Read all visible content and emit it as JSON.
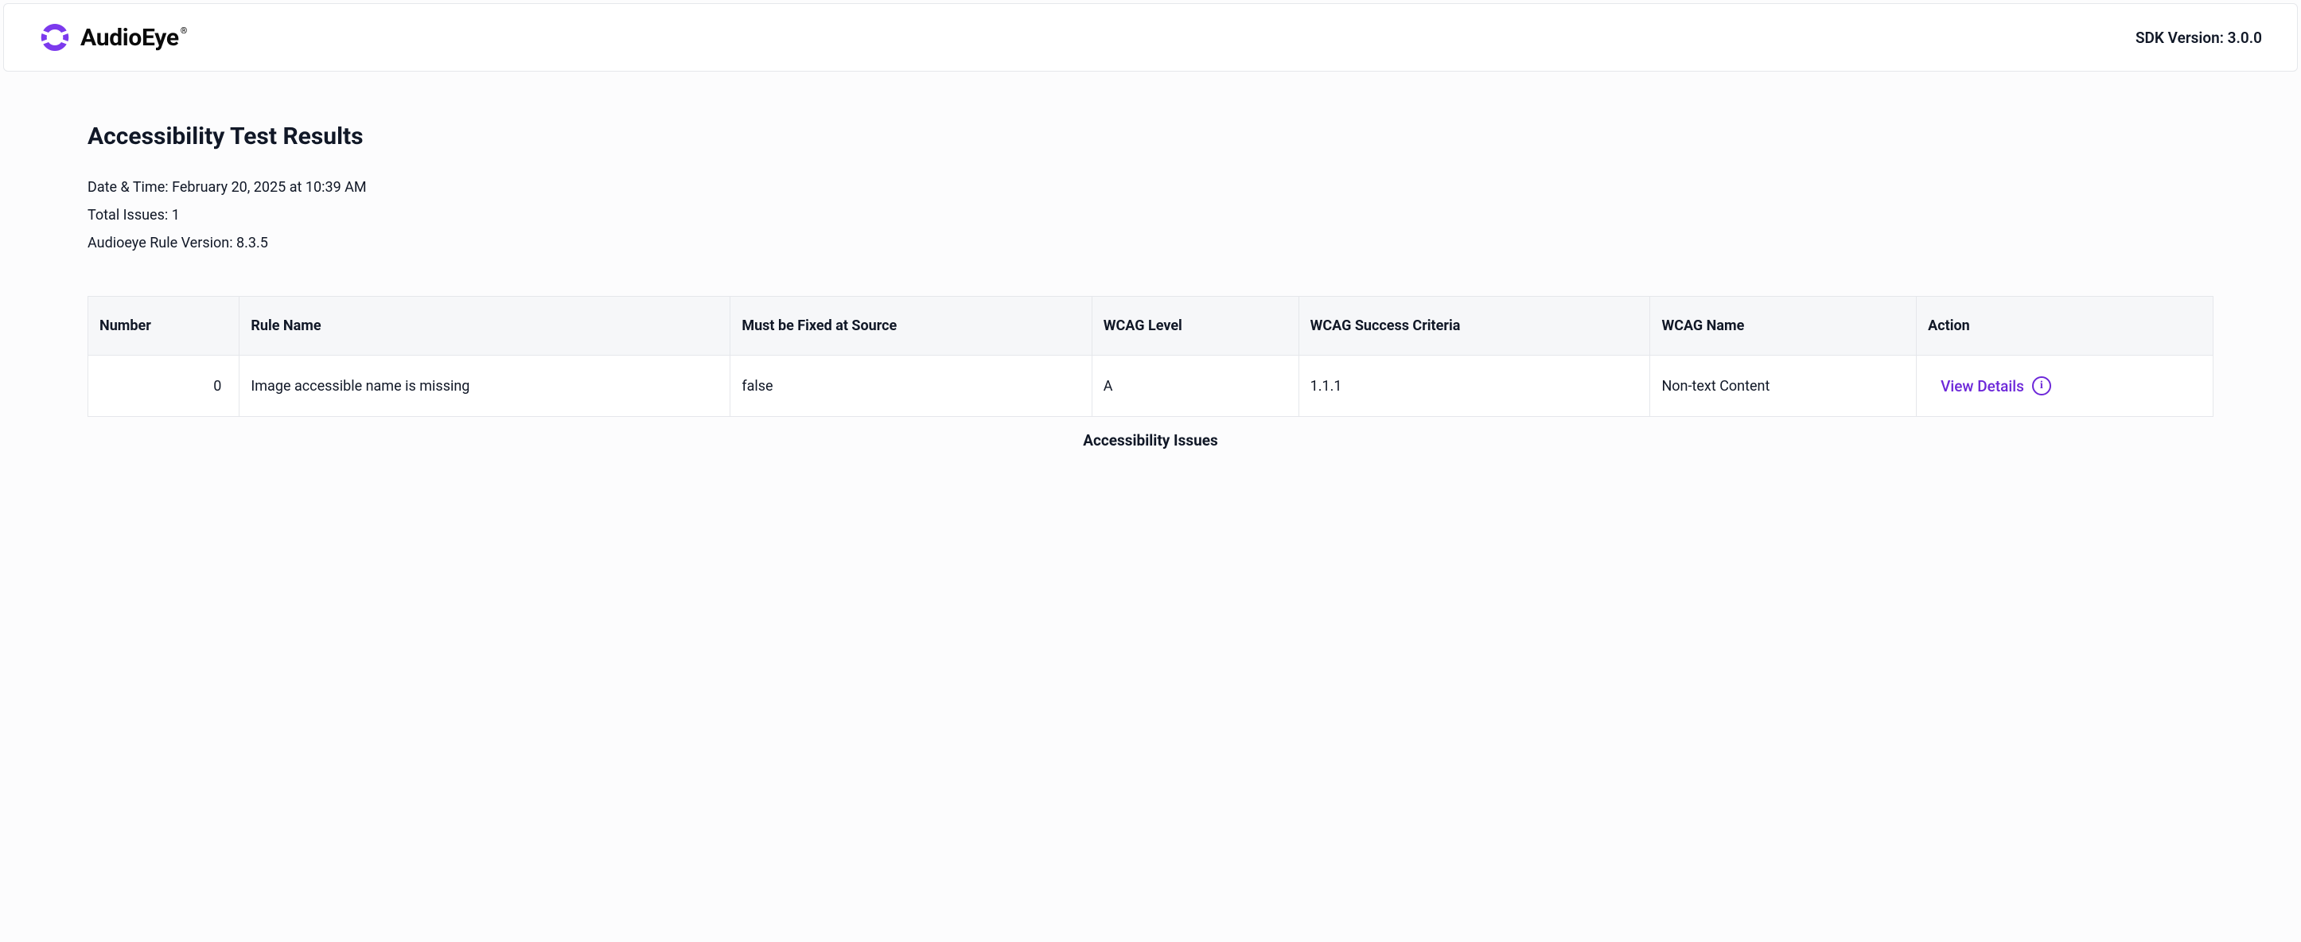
{
  "header": {
    "brand_name": "AudioEye",
    "sdk_version_label": "SDK Version: 3.0.0"
  },
  "main": {
    "title": "Accessibility Test Results",
    "meta": {
      "datetime_label": "Date & Time: ",
      "datetime_value": "February 20, 2025 at 10:39 AM",
      "total_issues_label": "Total Issues: ",
      "total_issues_value": "1",
      "rule_version_label": "Audioeye Rule Version: ",
      "rule_version_value": "8.3.5"
    },
    "table": {
      "headers": {
        "number": "Number",
        "rule_name": "Rule Name",
        "fix_source": "Must be Fixed at Source",
        "wcag_level": "WCAG Level",
        "wcag_criteria": "WCAG Success Criteria",
        "wcag_name": "WCAG Name",
        "action": "Action"
      },
      "rows": [
        {
          "number": "0",
          "rule_name": "Image accessible name is missing",
          "fix_source": "false",
          "wcag_level": "A",
          "wcag_criteria": "1.1.1",
          "wcag_name": "Non-text Content",
          "action_label": "View Details"
        }
      ],
      "caption": "Accessibility Issues"
    }
  }
}
